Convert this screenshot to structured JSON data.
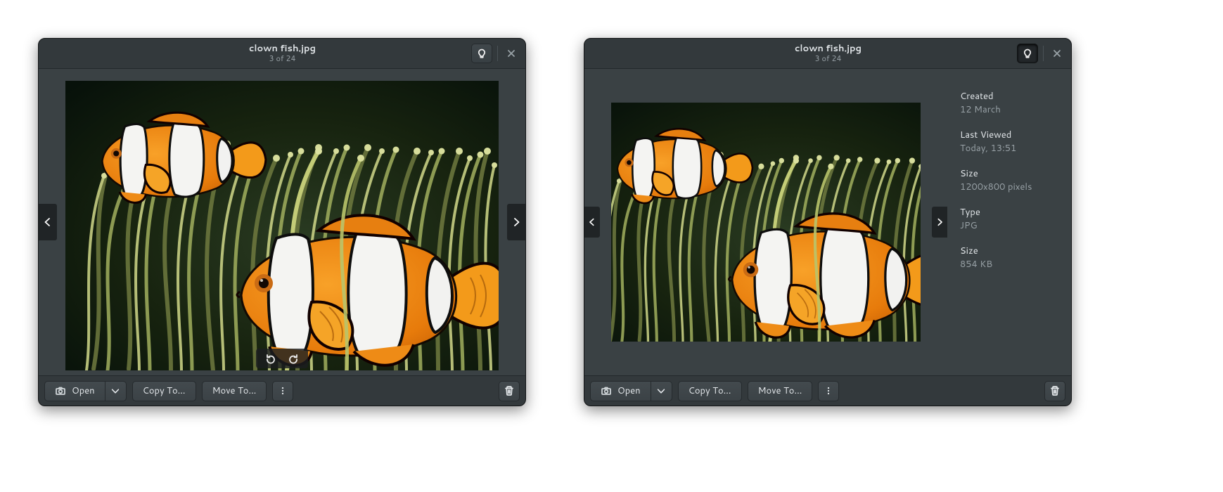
{
  "header": {
    "filename": "clown fish.jpg",
    "position": "3 of 24"
  },
  "bottom": {
    "open": "Open",
    "copy": "Copy To…",
    "move": "Move To…"
  },
  "meta": {
    "created_label": "Created",
    "created_value": "12 March",
    "viewed_label": "Last Viewed",
    "viewed_value": "Today, 13:51",
    "dim_label": "Size",
    "dim_value": "1200x800 pixels",
    "type_label": "Type",
    "type_value": "JPG",
    "bytes_label": "Size",
    "bytes_value": "854 KB"
  }
}
